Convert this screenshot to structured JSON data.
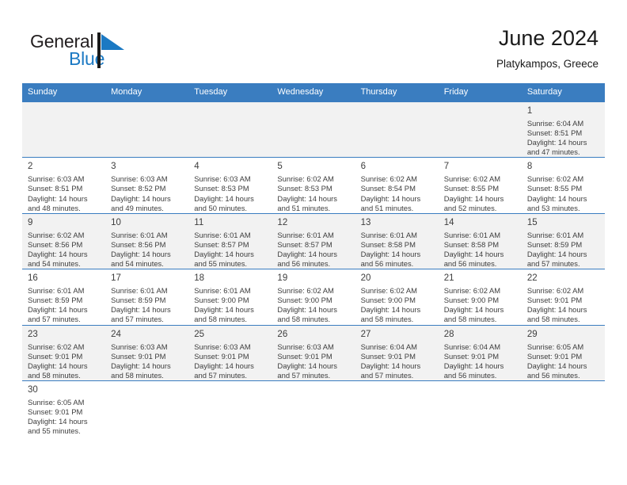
{
  "brand": {
    "name_top": "General",
    "name_bottom": "Blue",
    "flag_icon": "blue-flag-triangle-icon",
    "color_dark": "#231f20",
    "color_blue": "#1b79c3"
  },
  "header": {
    "title": "June 2024",
    "subtitle": "Platykampos, Greece"
  },
  "theme": {
    "header_row_bg": "#3a7dc0",
    "grid_line": "#3a7dc0",
    "shaded_row_bg": "#f2f2f2",
    "text": "#3d3d3d"
  },
  "calendar": {
    "weekday_headers": [
      "Sunday",
      "Monday",
      "Tuesday",
      "Wednesday",
      "Thursday",
      "Friday",
      "Saturday"
    ],
    "labels": {
      "sunrise": "Sunrise:",
      "sunset": "Sunset:",
      "daylight": "Daylight:"
    },
    "weeks": [
      [
        {
          "day": "",
          "empty": true
        },
        {
          "day": "",
          "empty": true
        },
        {
          "day": "",
          "empty": true
        },
        {
          "day": "",
          "empty": true
        },
        {
          "day": "",
          "empty": true
        },
        {
          "day": "",
          "empty": true
        },
        {
          "day": "1",
          "sunrise": "Sunrise: 6:04 AM",
          "sunset": "Sunset: 8:51 PM",
          "daylight1": "Daylight: 14 hours",
          "daylight2": "and 47 minutes."
        }
      ],
      [
        {
          "day": "2",
          "sunrise": "Sunrise: 6:03 AM",
          "sunset": "Sunset: 8:51 PM",
          "daylight1": "Daylight: 14 hours",
          "daylight2": "and 48 minutes."
        },
        {
          "day": "3",
          "sunrise": "Sunrise: 6:03 AM",
          "sunset": "Sunset: 8:52 PM",
          "daylight1": "Daylight: 14 hours",
          "daylight2": "and 49 minutes."
        },
        {
          "day": "4",
          "sunrise": "Sunrise: 6:03 AM",
          "sunset": "Sunset: 8:53 PM",
          "daylight1": "Daylight: 14 hours",
          "daylight2": "and 50 minutes."
        },
        {
          "day": "5",
          "sunrise": "Sunrise: 6:02 AM",
          "sunset": "Sunset: 8:53 PM",
          "daylight1": "Daylight: 14 hours",
          "daylight2": "and 51 minutes."
        },
        {
          "day": "6",
          "sunrise": "Sunrise: 6:02 AM",
          "sunset": "Sunset: 8:54 PM",
          "daylight1": "Daylight: 14 hours",
          "daylight2": "and 51 minutes."
        },
        {
          "day": "7",
          "sunrise": "Sunrise: 6:02 AM",
          "sunset": "Sunset: 8:55 PM",
          "daylight1": "Daylight: 14 hours",
          "daylight2": "and 52 minutes."
        },
        {
          "day": "8",
          "sunrise": "Sunrise: 6:02 AM",
          "sunset": "Sunset: 8:55 PM",
          "daylight1": "Daylight: 14 hours",
          "daylight2": "and 53 minutes."
        }
      ],
      [
        {
          "day": "9",
          "sunrise": "Sunrise: 6:02 AM",
          "sunset": "Sunset: 8:56 PM",
          "daylight1": "Daylight: 14 hours",
          "daylight2": "and 54 minutes."
        },
        {
          "day": "10",
          "sunrise": "Sunrise: 6:01 AM",
          "sunset": "Sunset: 8:56 PM",
          "daylight1": "Daylight: 14 hours",
          "daylight2": "and 54 minutes."
        },
        {
          "day": "11",
          "sunrise": "Sunrise: 6:01 AM",
          "sunset": "Sunset: 8:57 PM",
          "daylight1": "Daylight: 14 hours",
          "daylight2": "and 55 minutes."
        },
        {
          "day": "12",
          "sunrise": "Sunrise: 6:01 AM",
          "sunset": "Sunset: 8:57 PM",
          "daylight1": "Daylight: 14 hours",
          "daylight2": "and 56 minutes."
        },
        {
          "day": "13",
          "sunrise": "Sunrise: 6:01 AM",
          "sunset": "Sunset: 8:58 PM",
          "daylight1": "Daylight: 14 hours",
          "daylight2": "and 56 minutes."
        },
        {
          "day": "14",
          "sunrise": "Sunrise: 6:01 AM",
          "sunset": "Sunset: 8:58 PM",
          "daylight1": "Daylight: 14 hours",
          "daylight2": "and 56 minutes."
        },
        {
          "day": "15",
          "sunrise": "Sunrise: 6:01 AM",
          "sunset": "Sunset: 8:59 PM",
          "daylight1": "Daylight: 14 hours",
          "daylight2": "and 57 minutes."
        }
      ],
      [
        {
          "day": "16",
          "sunrise": "Sunrise: 6:01 AM",
          "sunset": "Sunset: 8:59 PM",
          "daylight1": "Daylight: 14 hours",
          "daylight2": "and 57 minutes."
        },
        {
          "day": "17",
          "sunrise": "Sunrise: 6:01 AM",
          "sunset": "Sunset: 8:59 PM",
          "daylight1": "Daylight: 14 hours",
          "daylight2": "and 57 minutes."
        },
        {
          "day": "18",
          "sunrise": "Sunrise: 6:01 AM",
          "sunset": "Sunset: 9:00 PM",
          "daylight1": "Daylight: 14 hours",
          "daylight2": "and 58 minutes."
        },
        {
          "day": "19",
          "sunrise": "Sunrise: 6:02 AM",
          "sunset": "Sunset: 9:00 PM",
          "daylight1": "Daylight: 14 hours",
          "daylight2": "and 58 minutes."
        },
        {
          "day": "20",
          "sunrise": "Sunrise: 6:02 AM",
          "sunset": "Sunset: 9:00 PM",
          "daylight1": "Daylight: 14 hours",
          "daylight2": "and 58 minutes."
        },
        {
          "day": "21",
          "sunrise": "Sunrise: 6:02 AM",
          "sunset": "Sunset: 9:00 PM",
          "daylight1": "Daylight: 14 hours",
          "daylight2": "and 58 minutes."
        },
        {
          "day": "22",
          "sunrise": "Sunrise: 6:02 AM",
          "sunset": "Sunset: 9:01 PM",
          "daylight1": "Daylight: 14 hours",
          "daylight2": "and 58 minutes."
        }
      ],
      [
        {
          "day": "23",
          "sunrise": "Sunrise: 6:02 AM",
          "sunset": "Sunset: 9:01 PM",
          "daylight1": "Daylight: 14 hours",
          "daylight2": "and 58 minutes."
        },
        {
          "day": "24",
          "sunrise": "Sunrise: 6:03 AM",
          "sunset": "Sunset: 9:01 PM",
          "daylight1": "Daylight: 14 hours",
          "daylight2": "and 58 minutes."
        },
        {
          "day": "25",
          "sunrise": "Sunrise: 6:03 AM",
          "sunset": "Sunset: 9:01 PM",
          "daylight1": "Daylight: 14 hours",
          "daylight2": "and 57 minutes."
        },
        {
          "day": "26",
          "sunrise": "Sunrise: 6:03 AM",
          "sunset": "Sunset: 9:01 PM",
          "daylight1": "Daylight: 14 hours",
          "daylight2": "and 57 minutes."
        },
        {
          "day": "27",
          "sunrise": "Sunrise: 6:04 AM",
          "sunset": "Sunset: 9:01 PM",
          "daylight1": "Daylight: 14 hours",
          "daylight2": "and 57 minutes."
        },
        {
          "day": "28",
          "sunrise": "Sunrise: 6:04 AM",
          "sunset": "Sunset: 9:01 PM",
          "daylight1": "Daylight: 14 hours",
          "daylight2": "and 56 minutes."
        },
        {
          "day": "29",
          "sunrise": "Sunrise: 6:05 AM",
          "sunset": "Sunset: 9:01 PM",
          "daylight1": "Daylight: 14 hours",
          "daylight2": "and 56 minutes."
        }
      ],
      [
        {
          "day": "30",
          "sunrise": "Sunrise: 6:05 AM",
          "sunset": "Sunset: 9:01 PM",
          "daylight1": "Daylight: 14 hours",
          "daylight2": "and 55 minutes."
        },
        {
          "day": "",
          "empty": true
        },
        {
          "day": "",
          "empty": true
        },
        {
          "day": "",
          "empty": true
        },
        {
          "day": "",
          "empty": true
        },
        {
          "day": "",
          "empty": true
        },
        {
          "day": "",
          "empty": true
        }
      ]
    ]
  }
}
